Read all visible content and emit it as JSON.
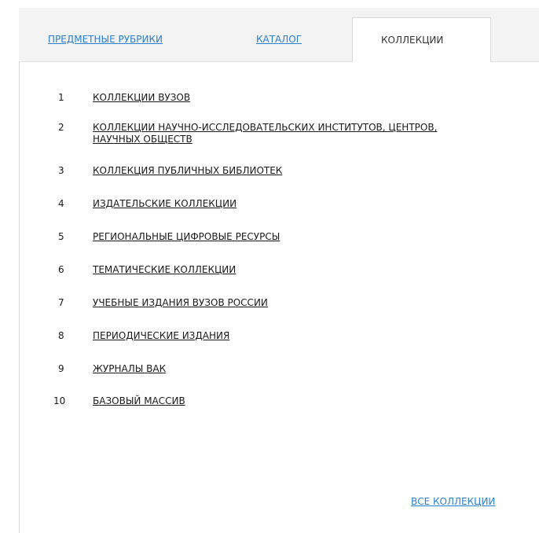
{
  "tabs": {
    "subjects": "ПРЕДМЕТНЫЕ РУБРИКИ",
    "catalog": "КАТАЛОГ",
    "collections": "КОЛЛЕКЦИИ"
  },
  "collections": [
    {
      "num": "1",
      "label": "КОЛЛЕКЦИИ ВУЗОВ"
    },
    {
      "num": "2",
      "label": "КОЛЛЕКЦИИ НАУЧНО-ИССЛЕДОВАТЕЛЬСКИХ ИНСТИТУТОВ, ЦЕНТРОВ, НАУЧНЫХ ОБЩЕСТВ"
    },
    {
      "num": "3",
      "label": "КОЛЛЕКЦИЯ ПУБЛИЧНЫХ БИБЛИОТЕК"
    },
    {
      "num": "4",
      "label": "ИЗДАТЕЛЬСКИЕ КОЛЛЕКЦИИ"
    },
    {
      "num": "5",
      "label": "РЕГИОНАЛЬНЫЕ ЦИФРОВЫЕ РЕСУРСЫ"
    },
    {
      "num": "6",
      "label": "ТЕМАТИЧЕСКИЕ КОЛЛЕКЦИИ"
    },
    {
      "num": "7",
      "label": "УЧЕБНЫЕ ИЗДАНИЯ ВУЗОВ РОССИИ"
    },
    {
      "num": "8",
      "label": "ПЕРИОДИЧЕСКИЕ ИЗДАНИЯ"
    },
    {
      "num": "9",
      "label": "ЖУРНАЛЫ ВАК"
    },
    {
      "num": "10",
      "label": "БАЗОВЫЙ МАССИВ"
    }
  ],
  "all_collections_link": "ВСЕ КОЛЛЕКЦИИ",
  "colors": {
    "link_blue": "#2a7fd0",
    "tab_bar_bg": "#f3f3f3",
    "text": "#1a1a1a"
  }
}
